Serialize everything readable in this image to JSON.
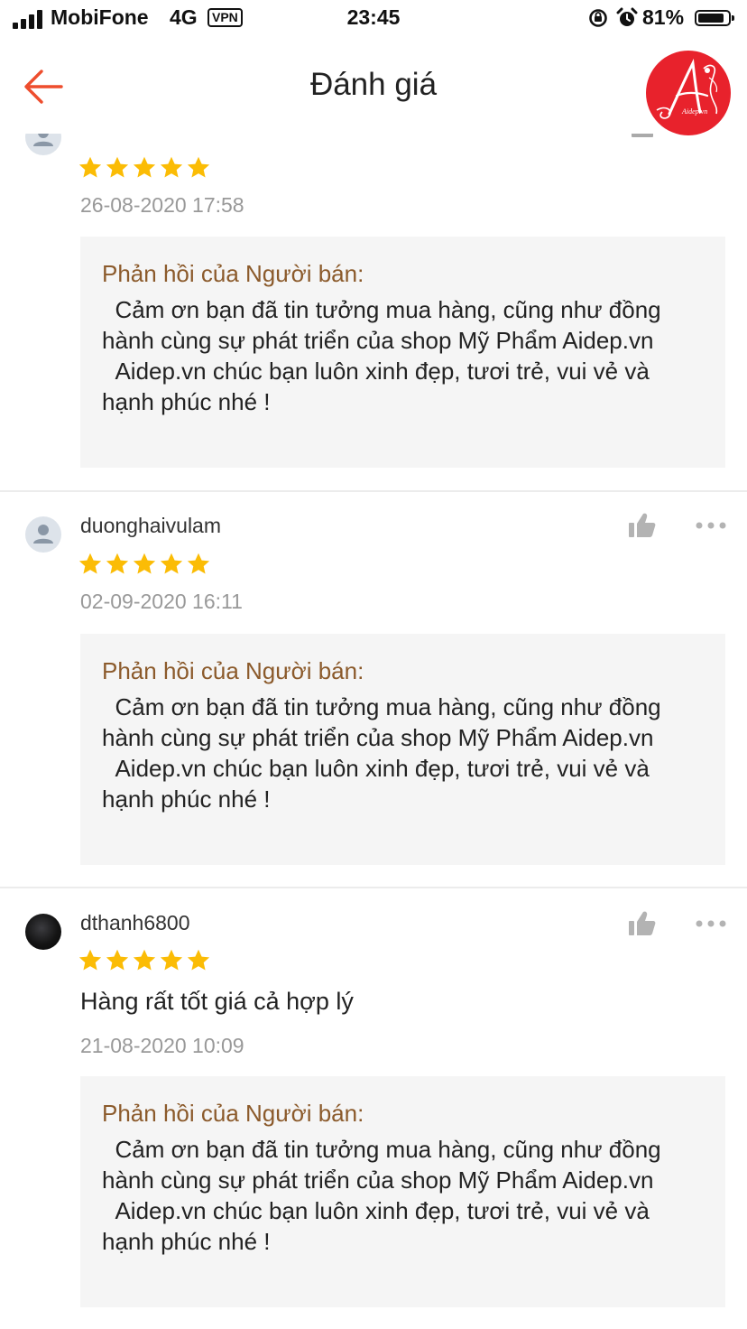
{
  "status_bar": {
    "carrier": "MobiFone",
    "network": "4G",
    "vpn": "VPN",
    "time": "23:45",
    "battery": "81%",
    "battery_level": 0.81
  },
  "header": {
    "title": "Đánh giá",
    "logo_text": "Aidep.vn"
  },
  "reviews": [
    {
      "username": "",
      "rating": 5,
      "comment": "",
      "date": "26-08-2020 17:58",
      "reply_title": "Phản hồi của Người bán:",
      "reply_text": "  Cảm ơn bạn đã tin tưởng mua hàng, cũng như đồng hành cùng sự phát triển của shop Mỹ Phẩm Aidep.vn\n  Aidep.vn chúc bạn luôn xinh đẹp, tươi trẻ, vui vẻ và hạnh phúc nhé !"
    },
    {
      "username": "duonghaivulam",
      "rating": 5,
      "comment": "",
      "date": "02-09-2020 16:11",
      "reply_title": "Phản hồi của Người bán:",
      "reply_text": "  Cảm ơn bạn đã tin tưởng mua hàng, cũng như đồng hành cùng sự phát triển của shop Mỹ Phẩm Aidep.vn\n  Aidep.vn chúc bạn luôn xinh đẹp, tươi trẻ, vui vẻ và hạnh phúc nhé !"
    },
    {
      "username": "dthanh6800",
      "rating": 5,
      "comment": "Hàng rất tốt giá cả hợp lý",
      "date": "21-08-2020 10:09",
      "reply_title": "Phản hồi của Người bán:",
      "reply_text": "  Cảm ơn bạn đã tin tưởng mua hàng, cũng như đồng hành cùng sự phát triển của shop Mỹ Phẩm Aidep.vn\n  Aidep.vn chúc bạn luôn xinh đẹp, tươi trẻ, vui vẻ và hạnh phúc nhé !"
    }
  ],
  "colors": {
    "accent": "#ee4d2d",
    "star": "#fbbc05",
    "reply_title": "#8b5a2b",
    "logo_bg": "#e8222c"
  },
  "icons": {
    "back": "arrow-left-icon",
    "like": "thumbs-up-icon",
    "more": "more-horizontal-icon",
    "avatar": "user-avatar-icon"
  }
}
